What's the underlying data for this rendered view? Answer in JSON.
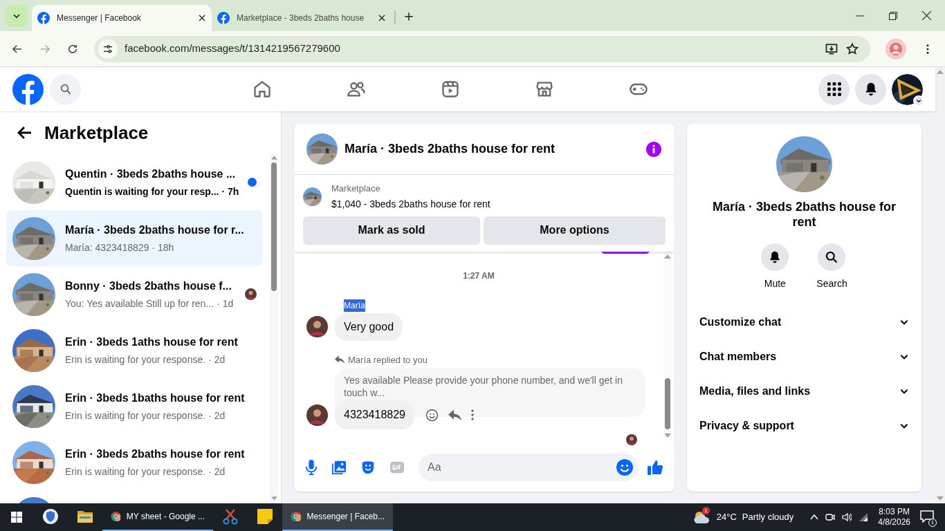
{
  "browser": {
    "tabs": [
      {
        "title": "Messenger | Facebook",
        "selected": true
      },
      {
        "title": "Marketplace - 3beds 2baths house",
        "selected": false
      }
    ],
    "url": "facebook.com/messages/t/1314219567279600"
  },
  "sidebar": {
    "title": "Marketplace",
    "conversations": [
      {
        "title": "Quentin · 3beds 2baths house ...",
        "preview": "Quentin is waiting for your resp...",
        "time": "· 7h",
        "unread": true,
        "seen": false,
        "selected": false
      },
      {
        "title": "María · 3beds 2baths house for r...",
        "preview": "María: 4323418829",
        "time": "· 18h",
        "unread": false,
        "seen": false,
        "selected": true
      },
      {
        "title": "Bonny · 3beds 2baths house f...",
        "preview": "You: Yes available Still up for ren...",
        "time": "· 1d",
        "unread": false,
        "seen": true,
        "selected": false
      },
      {
        "title": "Erin · 3beds 1aths house for rent",
        "preview": "Erin is waiting for your response.",
        "time": "· 2d",
        "unread": false,
        "seen": false,
        "selected": false
      },
      {
        "title": "Erin · 3beds 1baths house for rent",
        "preview": "Erin is waiting for your response.",
        "time": "· 2d",
        "unread": false,
        "seen": false,
        "selected": false
      },
      {
        "title": "Erin · 3beds 2baths house for rent",
        "preview": "Erin is waiting for your response.",
        "time": "· 2d",
        "unread": false,
        "seen": false,
        "selected": false
      }
    ]
  },
  "chat": {
    "title": "María · 3beds 2baths house for rent",
    "listing": {
      "label": "Marketplace",
      "text": "$1,040 - 3beds 2baths house for rent"
    },
    "buttons": [
      "Mark as sold",
      "More options"
    ],
    "timestamp": "1:27 AM",
    "sender": {
      "text": "María",
      "highlighted": true
    },
    "messages": [
      {
        "kind": "text",
        "text": "Very good"
      },
      {
        "kind": "reply",
        "reply_label": "María replied to you",
        "quote": "Yes available Please provide your phone number, and we'll get in touch w...",
        "text": "4323418829"
      }
    ],
    "composer": {
      "placeholder": "Aa"
    }
  },
  "details": {
    "title": "María · 3beds 2baths house for rent",
    "actions": [
      {
        "kind": "mute",
        "label": "Mute"
      },
      {
        "kind": "search",
        "label": "Search"
      }
    ],
    "sections": [
      "Customize chat",
      "Chat members",
      "Media, files and links",
      "Privacy & support"
    ]
  },
  "taskbar": {
    "apps": [
      {
        "kind": "security",
        "selected": false
      },
      {
        "kind": "explorer",
        "selected": false
      },
      {
        "kind": "chrome",
        "label": "MY sheet - Google ...",
        "selected": false
      },
      {
        "kind": "snip",
        "selected": false
      },
      {
        "kind": "notes",
        "selected": false
      },
      {
        "kind": "chrome",
        "label": "Messenger | Faceb...",
        "selected": true
      }
    ],
    "weather": {
      "badge": "1",
      "temp": "24°C",
      "text": "Partly cloudy"
    },
    "clock": {
      "time": "8:03 PM",
      "date": "4/8/2026"
    },
    "notifications": "1"
  }
}
